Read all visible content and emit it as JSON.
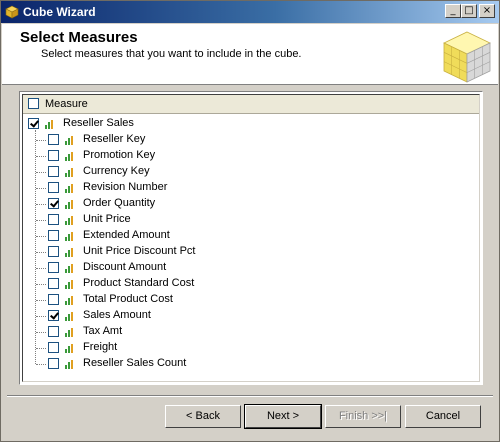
{
  "window": {
    "title": "Cube Wizard",
    "min_glyph": "_",
    "max_glyph": "□",
    "close_glyph": "×"
  },
  "header": {
    "title": "Select Measures",
    "subtitle": "Select measures that you want to include in the cube."
  },
  "measures": {
    "column_header": "Measure",
    "group": {
      "label": "Reseller Sales",
      "checked": true
    },
    "items": [
      {
        "label": "Reseller Key",
        "checked": false
      },
      {
        "label": "Promotion Key",
        "checked": false
      },
      {
        "label": "Currency Key",
        "checked": false
      },
      {
        "label": "Revision Number",
        "checked": false
      },
      {
        "label": "Order Quantity",
        "checked": true
      },
      {
        "label": "Unit Price",
        "checked": false
      },
      {
        "label": "Extended Amount",
        "checked": false
      },
      {
        "label": "Unit Price Discount Pct",
        "checked": false
      },
      {
        "label": "Discount Amount",
        "checked": false
      },
      {
        "label": "Product Standard Cost",
        "checked": false
      },
      {
        "label": "Total Product Cost",
        "checked": false
      },
      {
        "label": "Sales Amount",
        "checked": true
      },
      {
        "label": "Tax Amt",
        "checked": false
      },
      {
        "label": "Freight",
        "checked": false
      },
      {
        "label": "Reseller Sales Count",
        "checked": false
      }
    ]
  },
  "buttons": {
    "back": "< Back",
    "next": "Next >",
    "finish": "Finish >>|",
    "cancel": "Cancel"
  }
}
